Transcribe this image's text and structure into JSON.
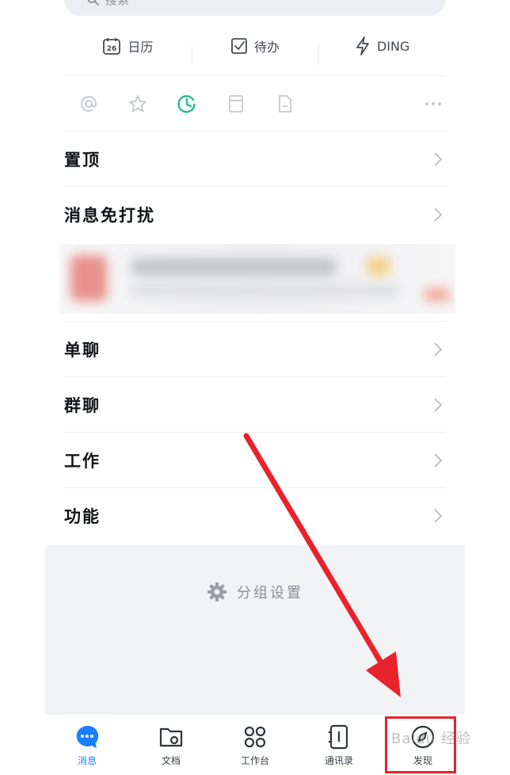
{
  "search": {
    "placeholder": "搜索"
  },
  "quick_actions": [
    {
      "label": "日历",
      "icon": "calendar-icon",
      "day": "26"
    },
    {
      "label": "待办",
      "icon": "todo-check-icon"
    },
    {
      "label": "DING",
      "icon": "lightning-icon"
    }
  ],
  "filters": [
    {
      "icon": "at-mention-icon"
    },
    {
      "icon": "star-icon"
    },
    {
      "icon": "clock-icon",
      "active": true
    },
    {
      "icon": "archive-box-icon"
    },
    {
      "icon": "document-icon"
    },
    {
      "icon": "more-dots-icon"
    }
  ],
  "menu": {
    "pinned": "置顶",
    "dnd": "消息免打扰",
    "single_chat": "单聊",
    "group_chat": "群聊",
    "work": "工作",
    "function": "功能"
  },
  "group_settings": {
    "label": "分组设置"
  },
  "tabs": [
    {
      "label": "消息",
      "icon": "message-bubble-icon",
      "active": true
    },
    {
      "label": "文档",
      "icon": "folder-icon"
    },
    {
      "label": "工作台",
      "icon": "workbench-grid-icon"
    },
    {
      "label": "通讯录",
      "icon": "contacts-book-icon"
    },
    {
      "label": "发现",
      "icon": "compass-icon"
    }
  ],
  "watermark": {
    "text": "Baidu 经验"
  },
  "colors": {
    "accent_blue": "#1a7fff",
    "active_green": "#1fbf8f",
    "highlight_red": "#e8232b"
  }
}
